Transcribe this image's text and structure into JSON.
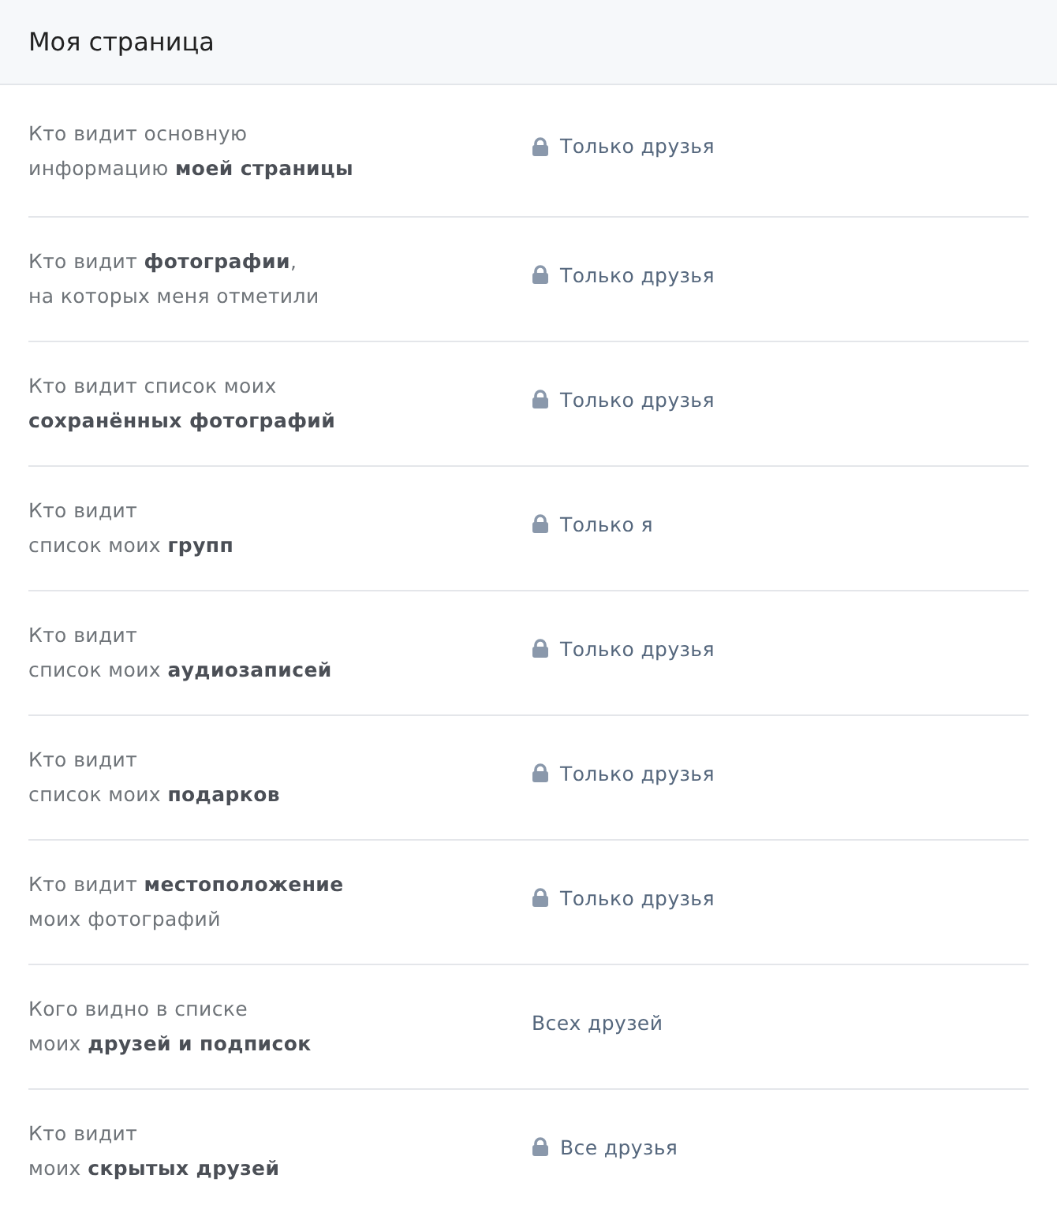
{
  "header": {
    "title": "Моя страница"
  },
  "settings": [
    {
      "label": [
        "Кто видит основную",
        "информацию **моей страницы**"
      ],
      "value": "Только друзья",
      "locked": true
    },
    {
      "label": [
        "Кто видит **фотографии**,",
        "на которых меня отметили"
      ],
      "value": "Только друзья",
      "locked": true
    },
    {
      "label": [
        "Кто видит список моих",
        "**сохранённых фотографий**"
      ],
      "value": "Только друзья",
      "locked": true
    },
    {
      "label": [
        "Кто видит",
        "список моих **групп**"
      ],
      "value": "Только я",
      "locked": true
    },
    {
      "label": [
        "Кто видит",
        "список моих **аудиозаписей**"
      ],
      "value": "Только друзья",
      "locked": true
    },
    {
      "label": [
        "Кто видит",
        "список моих **подарков**"
      ],
      "value": "Только друзья",
      "locked": true
    },
    {
      "label": [
        "Кто видит **местоположение**",
        "моих фотографий"
      ],
      "value": "Только друзья",
      "locked": true
    },
    {
      "label": [
        "Кого видно в списке",
        "моих **друзей и подписок**"
      ],
      "value": "Всех друзей",
      "locked": false
    },
    {
      "label": [
        "Кто видит",
        "моих **скрытых друзей**"
      ],
      "value": "Все друзья",
      "locked": true
    }
  ]
}
